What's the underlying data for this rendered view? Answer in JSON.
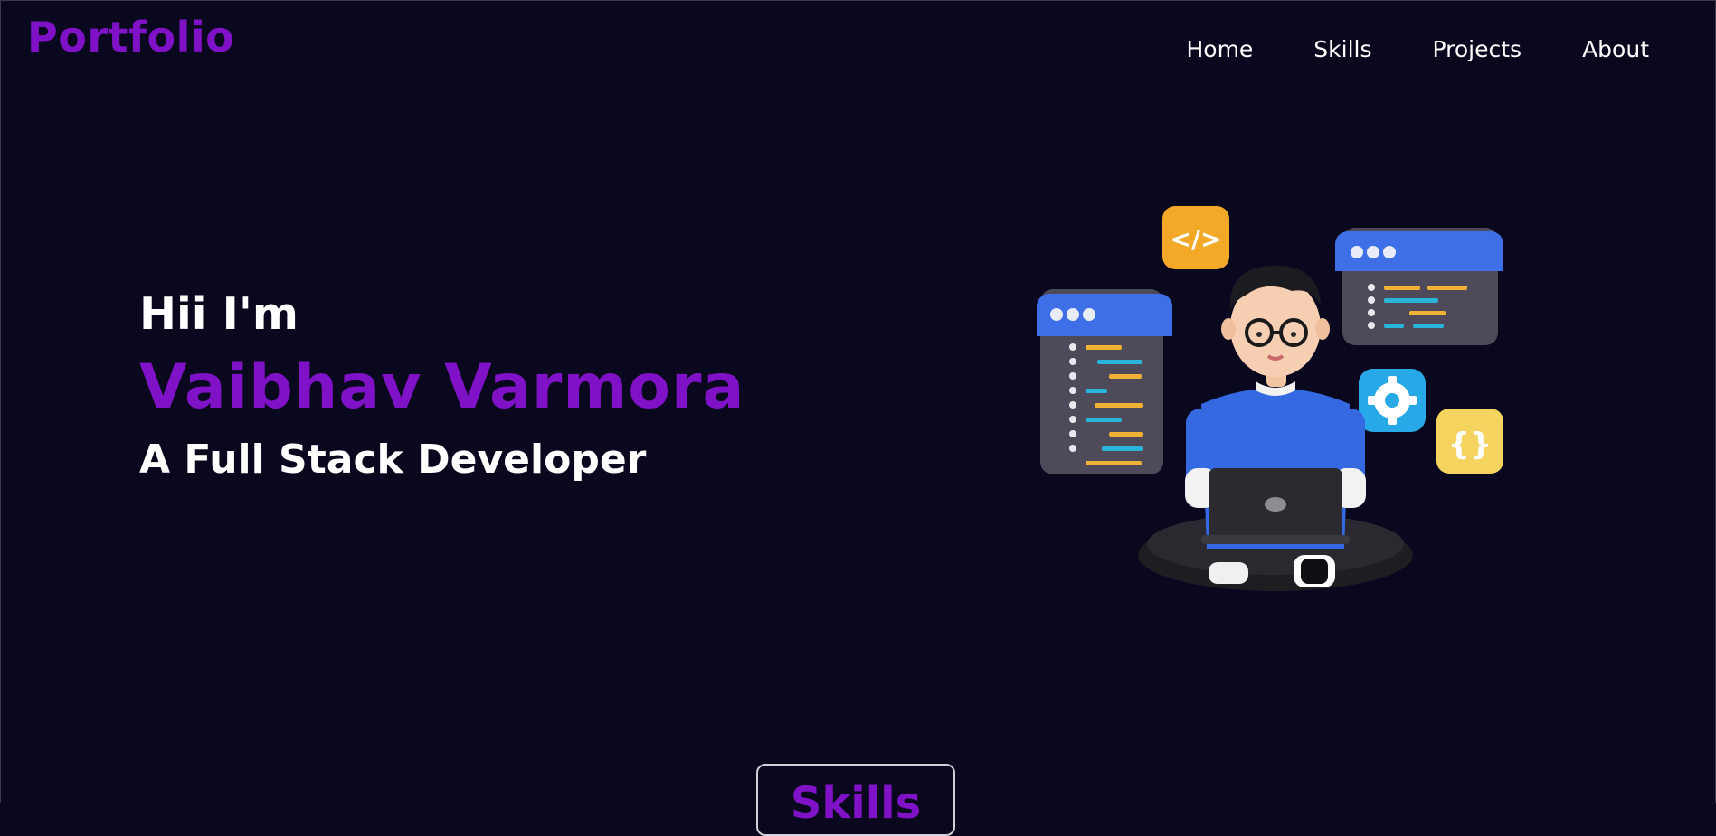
{
  "brand": {
    "logo": "Portfolio",
    "accent": "#7f12c7",
    "background": "#0a081e"
  },
  "nav": {
    "items": [
      {
        "label": "Home"
      },
      {
        "label": "Skills"
      },
      {
        "label": "Projects"
      },
      {
        "label": "About"
      }
    ]
  },
  "hero": {
    "greeting": "Hii I'm",
    "name": "Vaibhav Varmora",
    "role": "A Full Stack Developer",
    "illustration": "developer-with-laptop-illustration",
    "icons": [
      "code-tag-icon",
      "gear-icon",
      "curly-braces-icon",
      "code-window-icon"
    ]
  },
  "section": {
    "skills_heading": "Skills"
  }
}
